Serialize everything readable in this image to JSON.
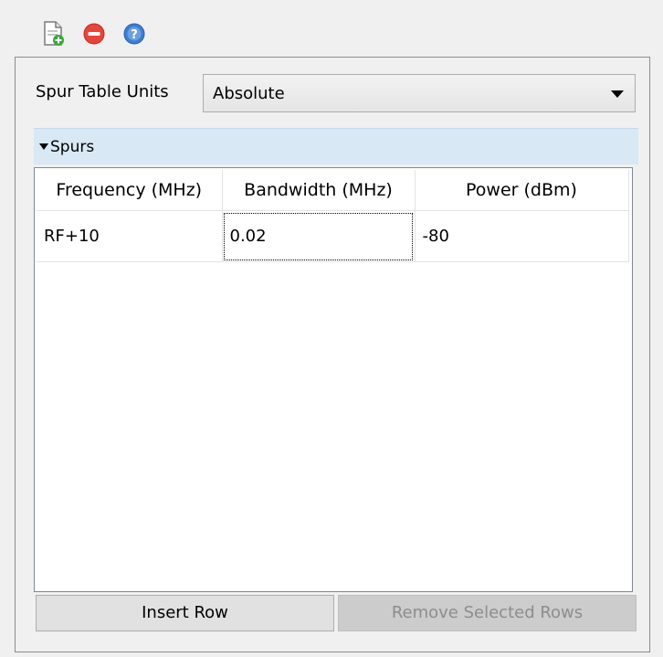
{
  "toolbar": {
    "items": [
      {
        "icon": "new-document-icon",
        "tooltip": ""
      },
      {
        "icon": "remove-icon",
        "tooltip": ""
      },
      {
        "icon": "help-icon",
        "tooltip": ""
      }
    ]
  },
  "settings": {
    "units_label": "Spur Table Units",
    "units_value": "Absolute"
  },
  "spurs": {
    "header": "Spurs",
    "columns": [
      "Frequency (MHz)",
      "Bandwidth (MHz)",
      "Power (dBm)"
    ],
    "rows": [
      [
        "RF+10",
        "0.02",
        "-80"
      ]
    ]
  },
  "buttons": {
    "insert_label": "Insert Row",
    "remove_label": "Remove Selected Rows"
  },
  "colors": {
    "header_bg": "#d9e8f5",
    "remove_icon": "#e8443a",
    "help_icon": "#3a7fd5",
    "doc_plus": "#3aa63a"
  }
}
